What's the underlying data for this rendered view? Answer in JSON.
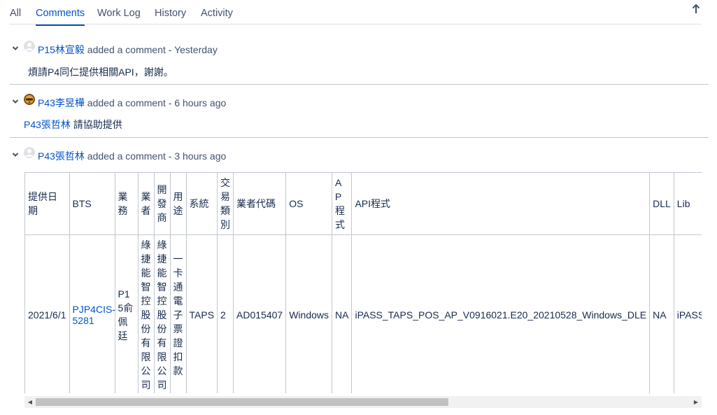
{
  "tabs": [
    {
      "label": "All"
    },
    {
      "label": "Comments"
    },
    {
      "label": "Work Log"
    },
    {
      "label": "History"
    },
    {
      "label": "Activity"
    }
  ],
  "active_tab": "Comments",
  "sort_icon": "arrow-up-icon",
  "comments": [
    {
      "author": "P15林宣毅",
      "action": " added a comment - ",
      "time": "Yesterday",
      "body": "煩請P4同仁提供相關API，謝謝。"
    },
    {
      "author": "P43李昱樺",
      "action": " added a comment - ",
      "time": "6 hours ago",
      "mention": "P43張哲林",
      "body": " 請協助提供"
    },
    {
      "author": "P43張哲林",
      "action": " added a comment - ",
      "time": "3 hours ago",
      "table": {
        "headers": [
          "提供日期",
          "BTS",
          "業務",
          "業者",
          "開發商",
          "用途",
          "系統",
          "交易類別",
          "業者代碼",
          "OS",
          "AP程式",
          "API程式",
          "DLL",
          "Lib"
        ],
        "row": [
          "2021/6/1",
          "PJP4CIS-5281",
          "P15俞佩廷",
          "綠捷能智控股份有限公司",
          "綠捷能智控股份有限公司",
          "一卡通電子票證扣款",
          "TAPS",
          "2",
          "AD015407",
          "Windows",
          "NA",
          "iPASS_TAPS_POS_AP_V0916021.E20_20210528_Windows_DLE",
          "NA",
          "iPASS_TAPS_D"
        ]
      }
    }
  ],
  "colors": {
    "link": "#0052cc",
    "text": "#172b4d",
    "border": "#c1c7d0"
  }
}
